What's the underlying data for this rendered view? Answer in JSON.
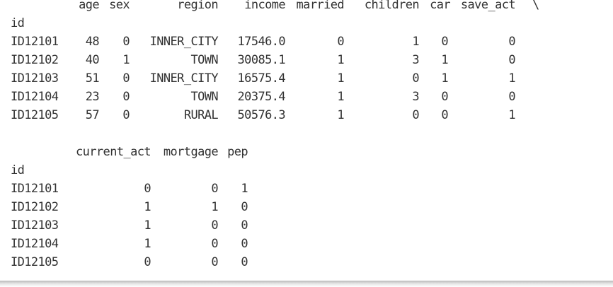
{
  "block1": {
    "columns": [
      "age",
      "sex",
      "region",
      "income",
      "married",
      "children",
      "car",
      "save_act"
    ],
    "continuation": "\\",
    "index_name": "id",
    "rows": [
      [
        "ID12101",
        "48",
        "0",
        "INNER_CITY",
        "17546.0",
        "0",
        "1",
        "0",
        "0"
      ],
      [
        "ID12102",
        "40",
        "1",
        "TOWN",
        "30085.1",
        "1",
        "3",
        "1",
        "0"
      ],
      [
        "ID12103",
        "51",
        "0",
        "INNER_CITY",
        "16575.4",
        "1",
        "0",
        "1",
        "1"
      ],
      [
        "ID12104",
        "23",
        "0",
        "TOWN",
        "20375.4",
        "1",
        "3",
        "0",
        "0"
      ],
      [
        "ID12105",
        "57",
        "0",
        "RURAL",
        "50576.3",
        "1",
        "0",
        "0",
        "1"
      ]
    ]
  },
  "block2": {
    "columns": [
      "current_act",
      "mortgage",
      "pep"
    ],
    "index_name": "id",
    "rows": [
      [
        "ID12101",
        "0",
        "0",
        "1"
      ],
      [
        "ID12102",
        "1",
        "1",
        "0"
      ],
      [
        "ID12103",
        "1",
        "0",
        "0"
      ],
      [
        "ID12104",
        "1",
        "0",
        "0"
      ],
      [
        "ID12105",
        "0",
        "0",
        "0"
      ]
    ]
  }
}
